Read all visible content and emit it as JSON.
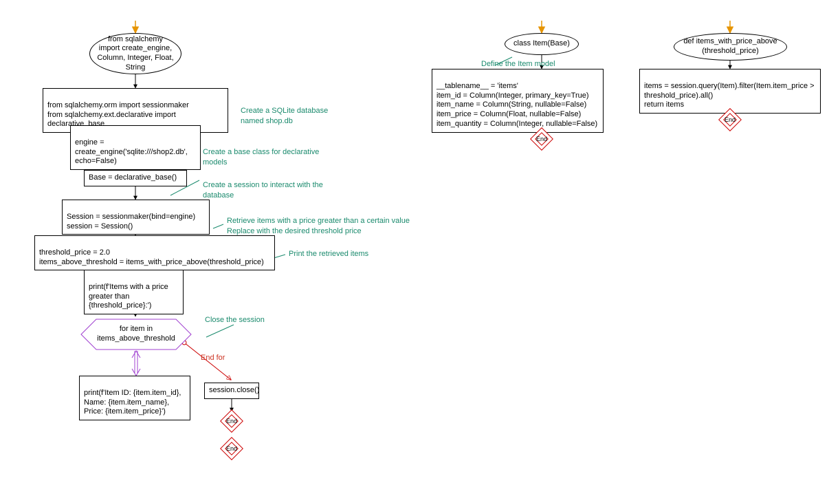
{
  "main": {
    "start": "from sqlalchemy import create_engine, Column, Integer, Float, String",
    "imports2": "from sqlalchemy.orm import sessionmaker\nfrom sqlalchemy.ext.declarative import declarative_base",
    "engine": "engine = create_engine('sqlite:///shop2.db', echo=False)",
    "base": "Base = declarative_base()",
    "session": "Session = sessionmaker(bind=engine)\nsession = Session()",
    "threshold": "threshold_price = 2.0\nitems_above_threshold = items_with_price_above(threshold_price)",
    "print_header": "print(f'Items with a price greater than {threshold_price}:')",
    "loop": "for item in items_above_threshold",
    "print_item": "print(f'Item ID: {item.item_id}, Name: {item.item_name}, Price: {item.item_price}')",
    "close": "session.close()",
    "end_for": "End for"
  },
  "annotations": {
    "a1": "Create a SQLite database named shop.db",
    "a2": "Create a base class for declarative models",
    "a3": "Create a session to interact with the database",
    "a4": "Retrieve items with a price greater than a certain value\nReplace with the desired threshold price",
    "a5": "Print the retrieved items",
    "a6": "Close the session",
    "a7": "Define the Item model"
  },
  "class_item": {
    "header": "class Item(Base)",
    "body": "__tablename__ = 'items'\nitem_id = Column(Integer, primary_key=True)\nitem_name = Column(String, nullable=False)\nitem_price = Column(Float, nullable=False)\nitem_quantity = Column(Integer, nullable=False)"
  },
  "func": {
    "header": "def items_with_price_above (threshold_price)",
    "body": "items = session.query(Item).filter(Item.item_price > threshold_price).all()\nreturn items"
  },
  "end_label": "End"
}
